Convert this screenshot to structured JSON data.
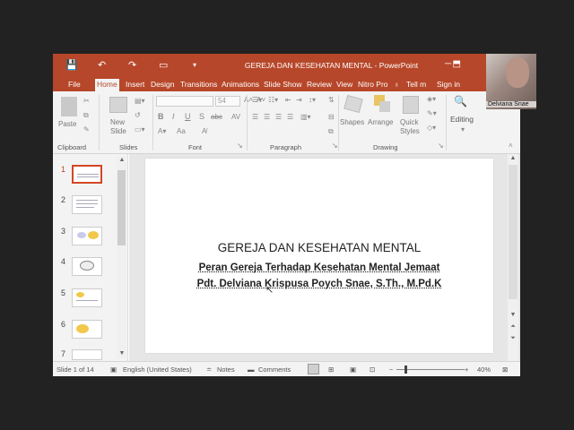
{
  "window": {
    "title": "GEREJA DAN KESEHATAN MENTAL  -  PowerPoint",
    "qat": {
      "save": "💾",
      "undo": "↶",
      "redo": "↷",
      "present": "▭",
      "customize": "▾"
    }
  },
  "tabs": [
    "File",
    "Home",
    "Insert",
    "Design",
    "Transitions",
    "Animations",
    "Slide Show",
    "Review",
    "View",
    "Nitro Pro",
    "Tell m",
    "Sign in"
  ],
  "active_tab": "Home",
  "ribbon": {
    "groups": [
      "Clipboard",
      "Slides",
      "Font",
      "Paragraph",
      "Drawing",
      "Editing"
    ],
    "clipboard": {
      "paste": "Paste"
    },
    "slides": {
      "new_slide": "New\nSlide"
    },
    "font": {
      "size": "54",
      "bold": "B",
      "italic": "I",
      "underline": "U",
      "strike": "S",
      "shadow": "abc",
      "aa": "Aa",
      "grow": "A˄",
      "shrink": "A˅"
    },
    "drawing": {
      "shapes": "Shapes",
      "arrange": "Arrange",
      "quick_styles": "Quick\nStyles"
    },
    "editing": {
      "label": "Editing"
    }
  },
  "thumbnails": {
    "numbers": [
      "1",
      "2",
      "3",
      "4",
      "5",
      "6",
      "7"
    ],
    "selected": "1"
  },
  "slide": {
    "title": "GEREJA DAN KESEHATAN MENTAL",
    "subtitle1": "Peran Gereja Terhadap Kesehatan Mental Jemaat",
    "subtitle2": "Pdt. Delviana Krispusa Poych Snae, S.Th., M.Pd.K"
  },
  "status": {
    "slide_info": "Slide 1 of 14",
    "language": "English (United States)",
    "notes": "Notes",
    "comments": "Comments",
    "zoom": "40%"
  },
  "webcam": {
    "name": "Delviana Snae"
  },
  "colors": {
    "accent": "#b7472a",
    "ribbon_bg": "#f3f3f3",
    "editor_bg": "#e6e6e6"
  }
}
